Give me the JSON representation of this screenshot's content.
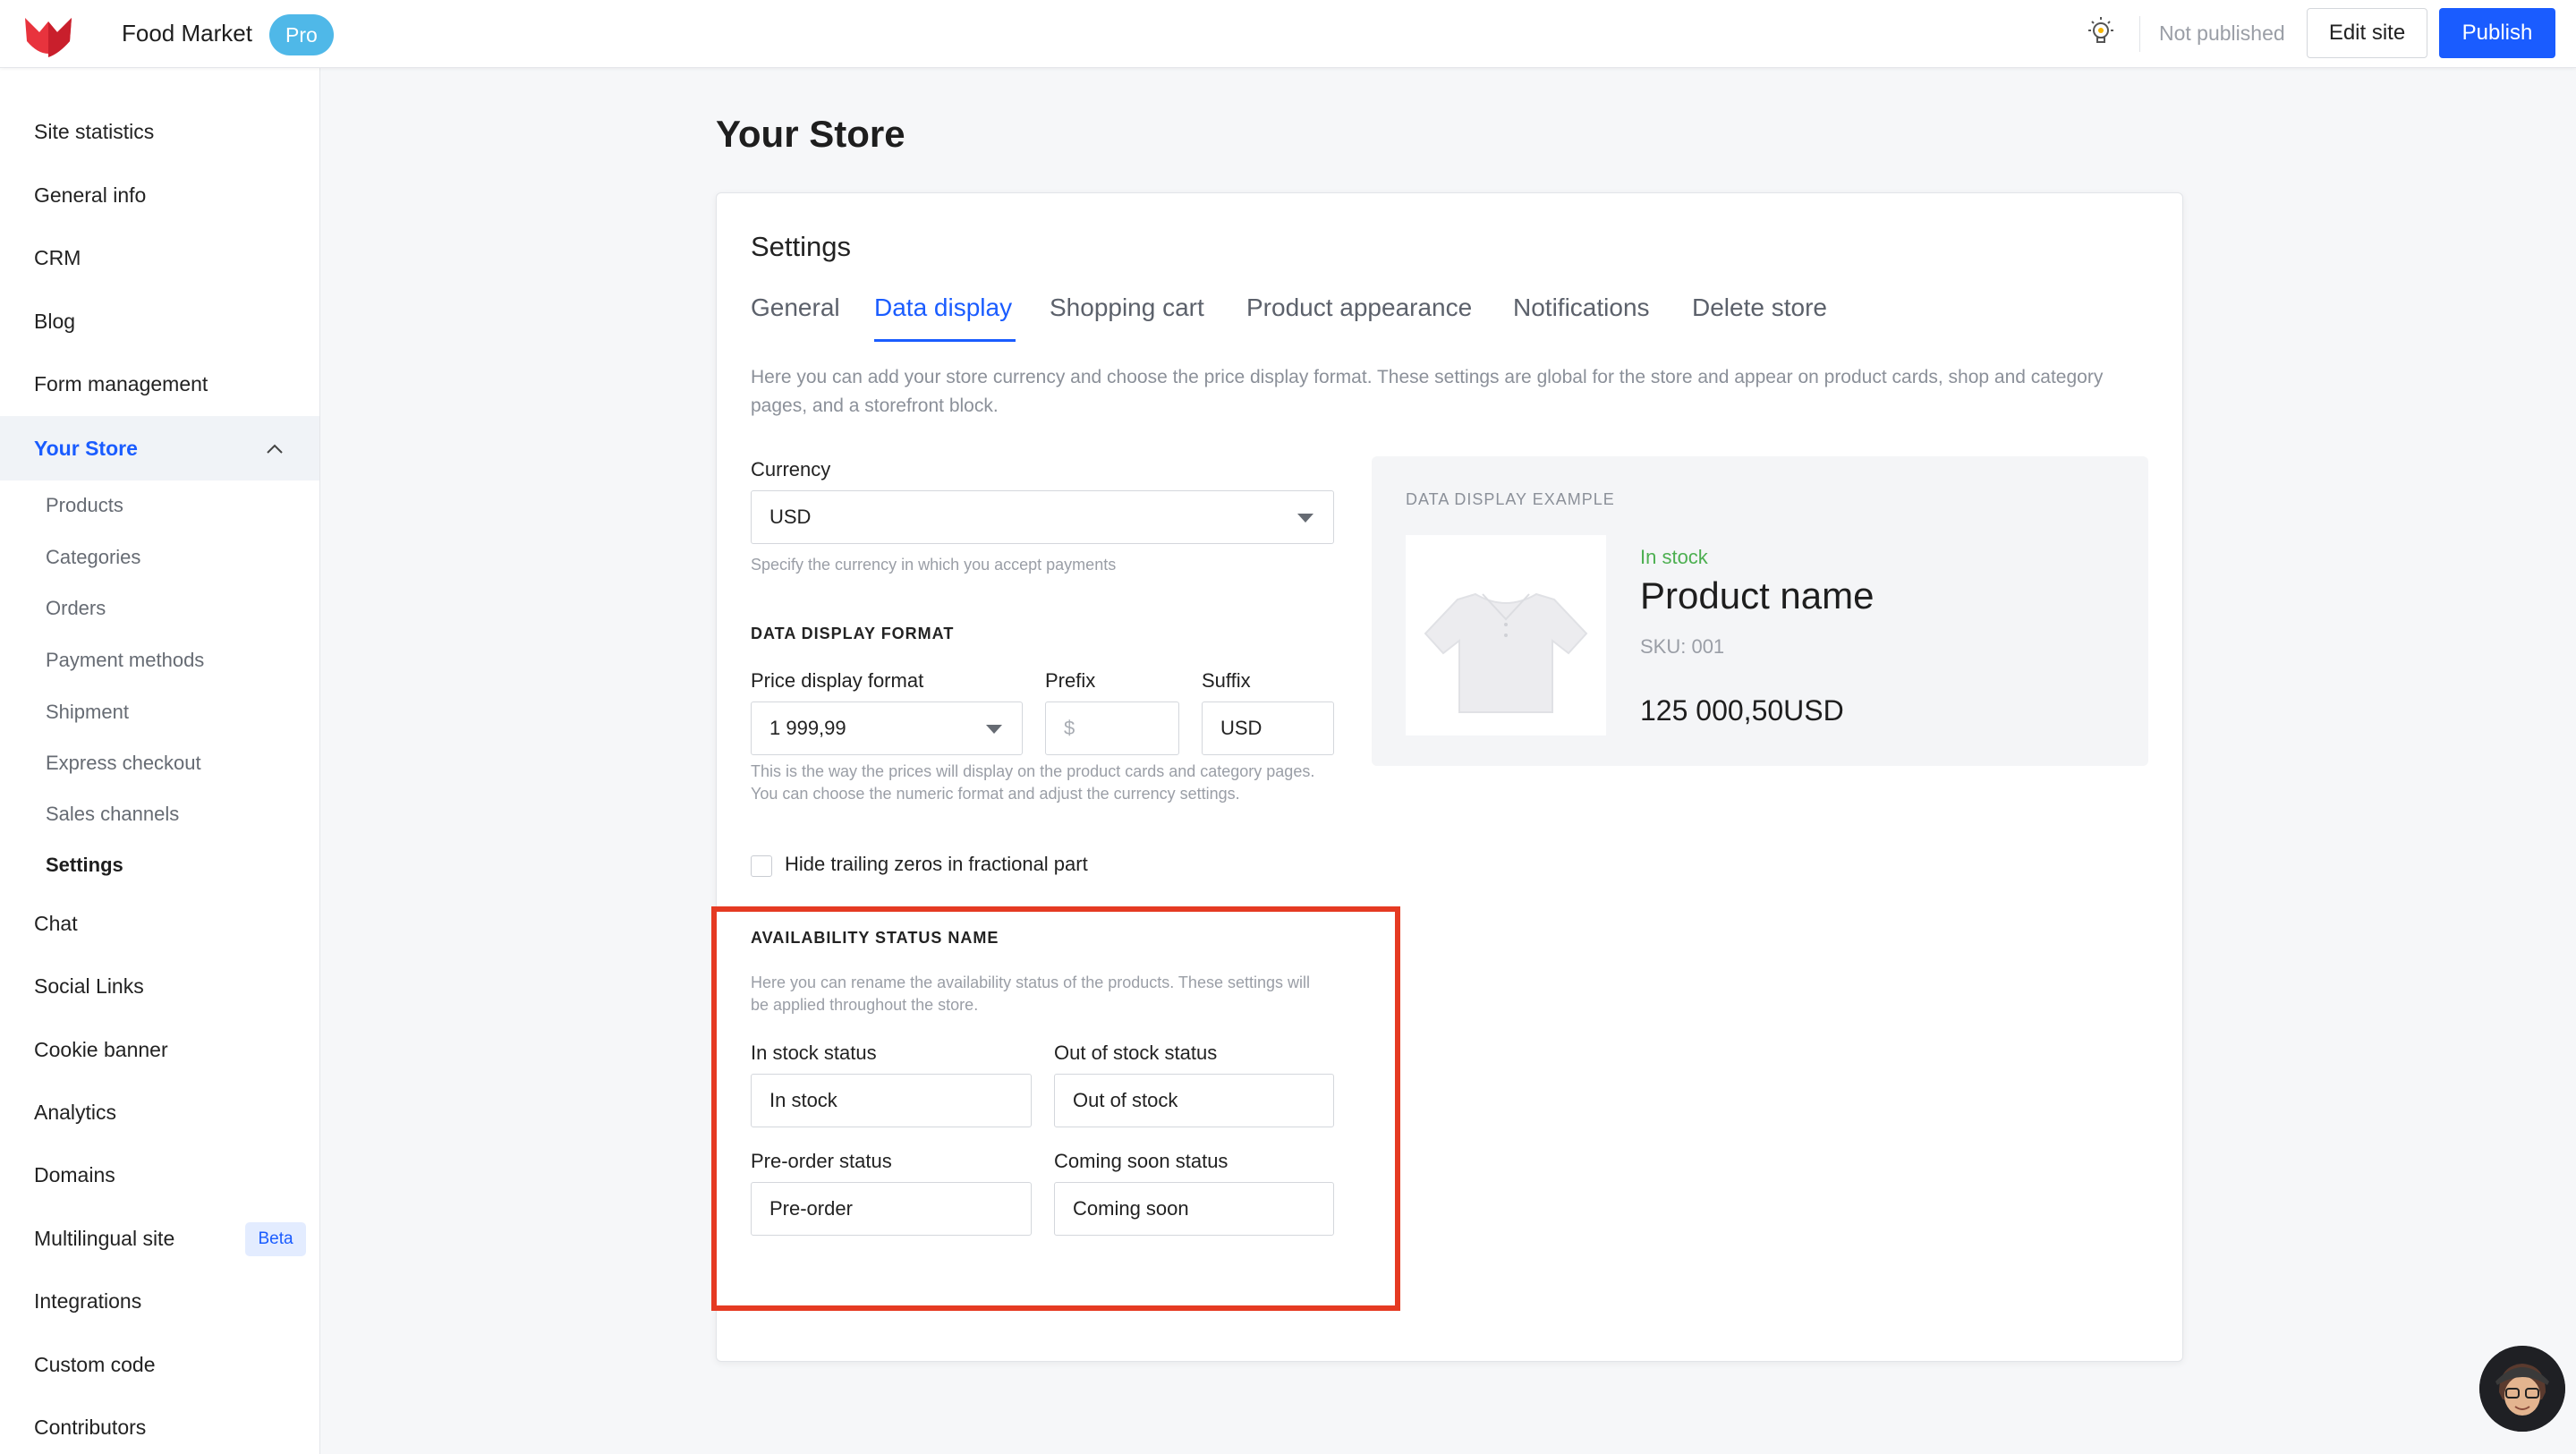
{
  "header": {
    "app_title": "Food Market",
    "plan_badge": "Pro",
    "publish_status": "Not published",
    "edit_site_label": "Edit site",
    "publish_label": "Publish",
    "accent": "#1a5cff"
  },
  "sidebar": {
    "items_top": [
      "Site statistics",
      "General info",
      "CRM",
      "Blog",
      "Form management"
    ],
    "active_section": "Your Store",
    "sub_items": [
      "Products",
      "Categories",
      "Orders",
      "Payment methods",
      "Shipment",
      "Express checkout",
      "Sales channels",
      "Settings"
    ],
    "items_bottom": [
      "Chat",
      "Social Links",
      "Cookie banner",
      "Analytics",
      "Domains",
      "Multilingual site",
      "Integrations",
      "Custom code",
      "Contributors"
    ],
    "beta_badge": "Beta"
  },
  "page": {
    "title": "Your Store"
  },
  "settings": {
    "title": "Settings",
    "tabs": [
      "General",
      "Data display",
      "Shopping cart",
      "Product appearance",
      "Notifications",
      "Delete store"
    ],
    "active_tab": "Data display",
    "intro": "Here you can add your store currency and choose the price display format. These settings are global for the store and appear on product cards, shop and category pages, and a storefront block.",
    "currency": {
      "label": "Currency",
      "value": "USD",
      "hint": "Specify the currency in which you accept payments"
    },
    "format": {
      "section_title": "DATA DISPLAY FORMAT",
      "price_label": "Price display format",
      "price_value": "1 999,99",
      "prefix_label": "Prefix",
      "prefix_placeholder": "$",
      "suffix_label": "Suffix",
      "suffix_value": "USD",
      "hint": "This is the way the prices will display on the product cards and category pages. You can choose the numeric format and adjust the currency settings.",
      "hide_zeros_label": "Hide trailing zeros in fractional part"
    },
    "availability": {
      "section_title": "AVAILABILITY STATUS NAME",
      "hint": "Here you can rename the availability status of the products. These settings will be applied throughout the store.",
      "in_stock_label": "In stock status",
      "in_stock_value": "In stock",
      "out_of_stock_label": "Out of stock status",
      "out_of_stock_value": "Out of stock",
      "preorder_label": "Pre-order status",
      "preorder_value": "Pre-order",
      "coming_soon_label": "Coming soon status",
      "coming_soon_value": "Coming soon"
    },
    "example": {
      "title": "DATA DISPLAY EXAMPLE",
      "stock": "In stock",
      "product_name": "Product name",
      "sku": "SKU: 001",
      "price": "125 000,50USD"
    }
  }
}
